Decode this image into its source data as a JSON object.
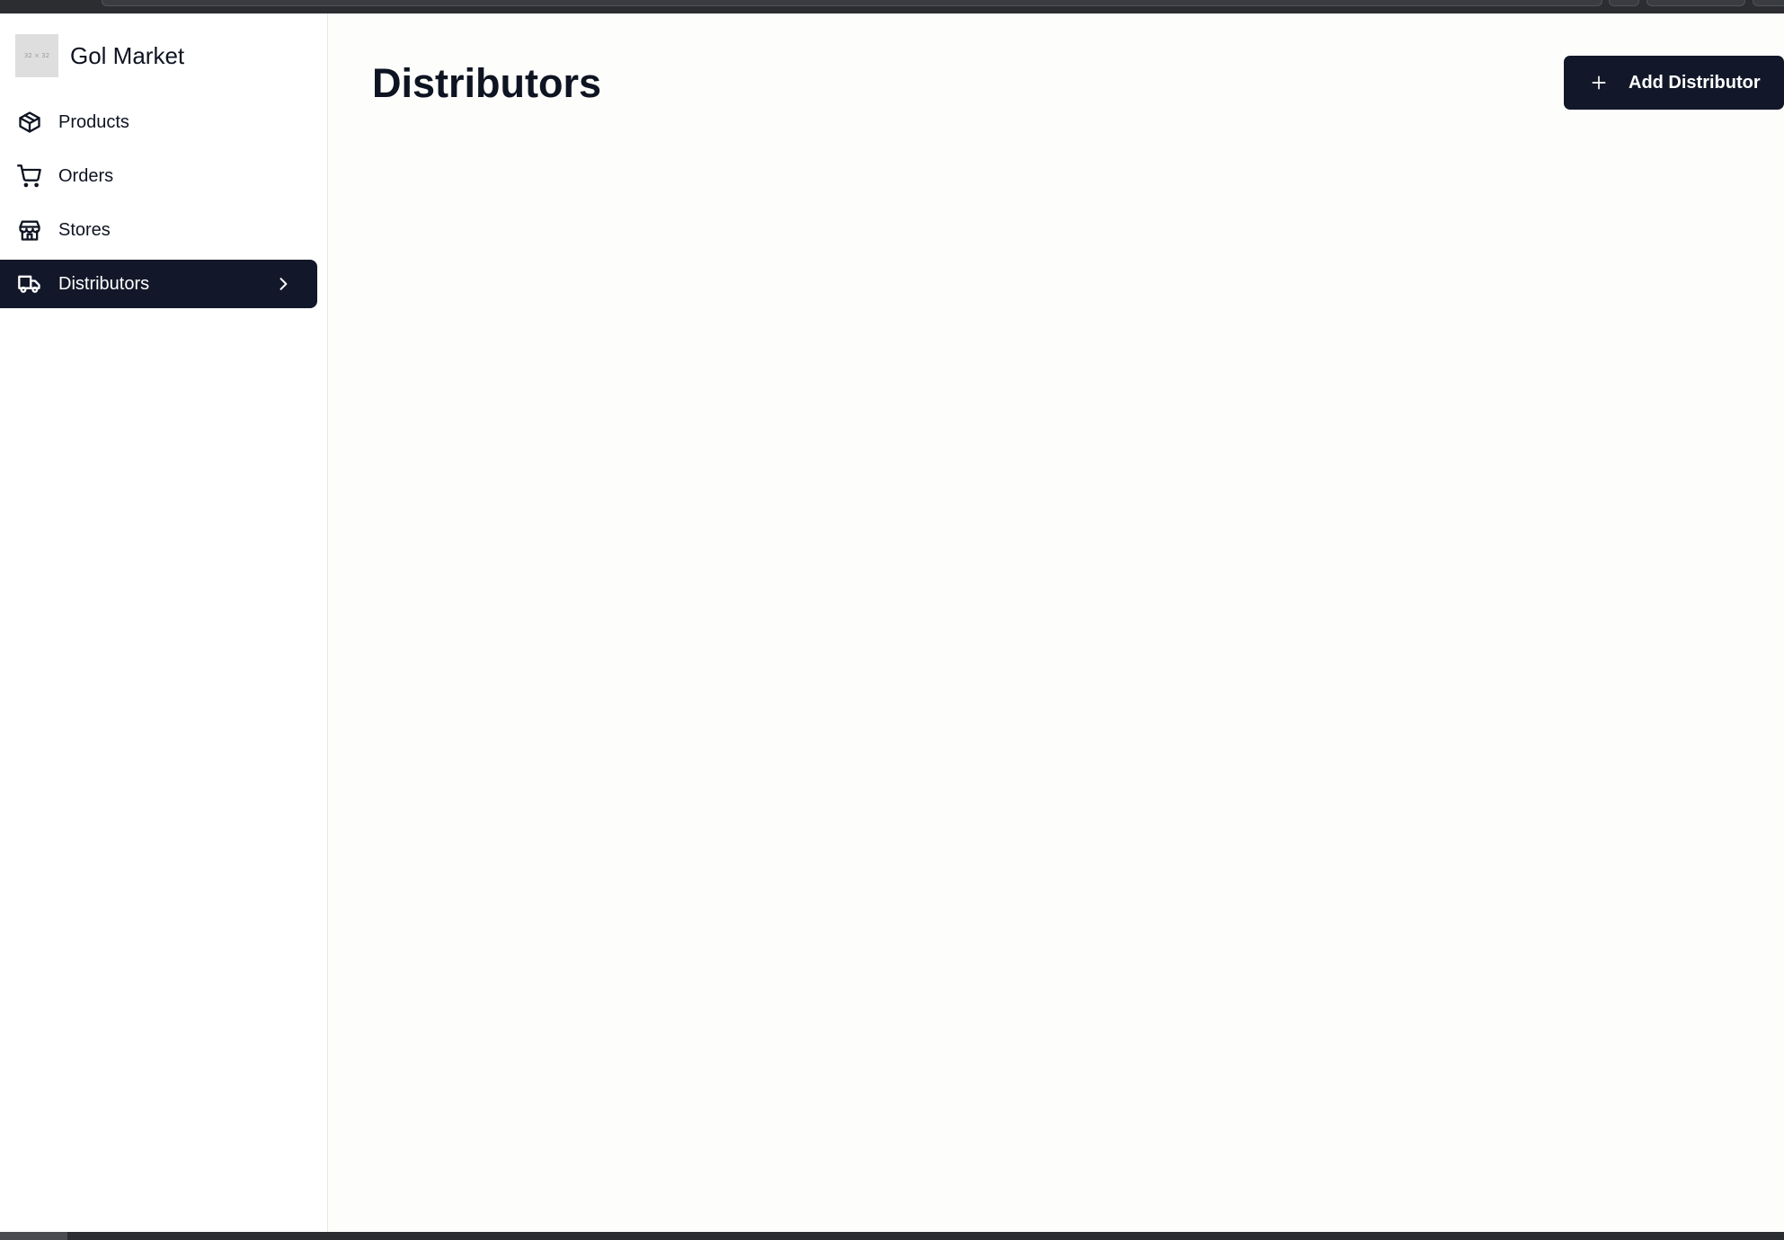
{
  "app": {
    "name": "Gol Market",
    "logo_text": "32 × 32"
  },
  "sidebar": {
    "items": [
      {
        "label": "Products",
        "icon": "package-icon",
        "active": false
      },
      {
        "label": "Orders",
        "icon": "shopping-cart-icon",
        "active": false
      },
      {
        "label": "Stores",
        "icon": "store-icon",
        "active": false
      },
      {
        "label": "Distributors",
        "icon": "truck-icon",
        "active": true
      }
    ]
  },
  "main": {
    "title": "Distributors",
    "add_button_label": "Add Distributor",
    "add_button_icon": "plus-icon"
  },
  "colors": {
    "primary": "#121829",
    "background": "#fdfdfb",
    "sidebar_bg": "#ffffff"
  }
}
